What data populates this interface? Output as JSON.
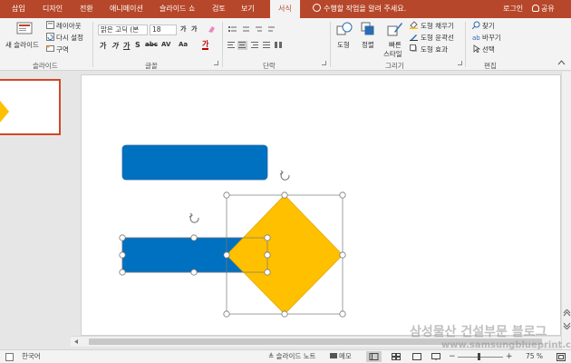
{
  "tabs": [
    {
      "label": "삽입"
    },
    {
      "label": "디자인"
    },
    {
      "label": "전환"
    },
    {
      "label": "애니메이션"
    },
    {
      "label": "슬라이드 쇼"
    },
    {
      "label": "검토"
    },
    {
      "label": "보기"
    },
    {
      "label": "서식"
    }
  ],
  "active_tab": "서식",
  "tell_me": "수행할 작업을 알려 주세요.",
  "account": {
    "login": "로그인",
    "share": "공유"
  },
  "ribbon": {
    "slides": {
      "new_slide": "새 슬라이드",
      "layout": "레이아웃",
      "reset": "다시 설정",
      "section": "구역",
      "label": "슬라이드"
    },
    "font": {
      "name": "맑은 고딕 (본",
      "size": "18",
      "label": "글꼴"
    },
    "paragraph": {
      "label": "단락"
    },
    "drawing": {
      "shapes": "도형",
      "arrange": "정렬",
      "quick_styles_1": "빠른",
      "quick_styles_2": "스타일",
      "fill": "도형 채우기",
      "outline": "도형 윤곽선",
      "effects": "도형 효과",
      "label": "그리기"
    },
    "editing": {
      "find": "찾기",
      "replace": "바꾸기",
      "select": "선택",
      "label": "편집"
    }
  },
  "statusbar": {
    "language": "한국어",
    "notes": "슬라이드 노트",
    "comments": "메모",
    "zoom": "75 %"
  },
  "watermark": {
    "line1": "삼성물산 건설부문 블로그",
    "line2": "www.samsungblueprint.com"
  },
  "colors": {
    "accent": "#b7472a",
    "rect_fill": "#0070c0",
    "diamond_fill": "#ffc000",
    "thumb_border": "#d24726"
  }
}
